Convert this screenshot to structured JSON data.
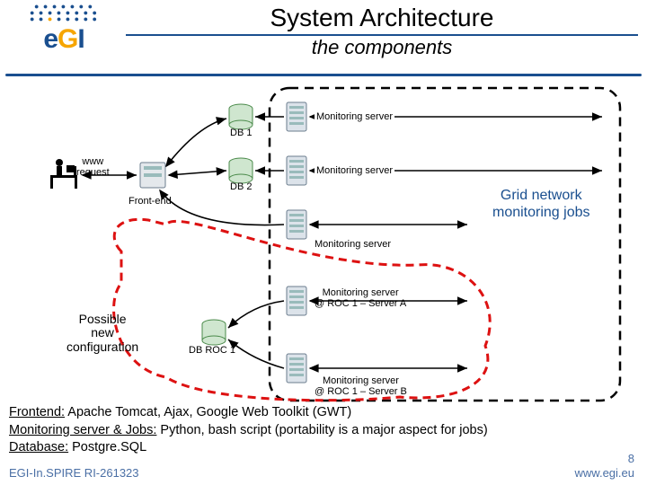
{
  "logo": {
    "text_prefix": "e",
    "text_mid": "G",
    "text_suffix": "I"
  },
  "title": {
    "main": "System Architecture",
    "sub": "the components"
  },
  "labels": {
    "www_request": "www\nrequest",
    "frontend": "Front-end",
    "db1": "DB 1",
    "db2": "DB 2",
    "dbroc1": "DB ROC 1",
    "mon1": "Monitoring server",
    "mon2": "Monitoring server",
    "mon3": "Monitoring server",
    "mon_roc_a": "Monitoring server\n@ ROC 1 – Server A",
    "mon_roc_b": "Monitoring server\n@ ROC 1 – Server B",
    "possible": "Possible\nnew\nconfiguration",
    "grid": "Grid network\nmonitoring jobs"
  },
  "footer": {
    "line1_u": "Frontend:",
    "line1_rest": " Apache Tomcat, Ajax, Google Web Toolkit (GWT)",
    "line2_u": "Monitoring server & Jobs:",
    "line2_rest": " Python, bash script (portability is a major aspect for jobs)",
    "line3_u": "Database:",
    "line3_rest": " Postgre.SQL"
  },
  "ref": "EGI-In.SPIRE RI-261323",
  "pagenum": "8",
  "siteurl": "www.egi.eu",
  "chart_data": {
    "type": "diagram",
    "title": "System Architecture – the components",
    "nodes": [
      {
        "id": "user",
        "label": "www request",
        "type": "actor"
      },
      {
        "id": "frontend",
        "label": "Front-end",
        "type": "server"
      },
      {
        "id": "db1",
        "label": "DB 1",
        "type": "database"
      },
      {
        "id": "db2",
        "label": "DB 2",
        "type": "database"
      },
      {
        "id": "mon1",
        "label": "Monitoring server",
        "type": "server",
        "group": "grid"
      },
      {
        "id": "mon2",
        "label": "Monitoring server",
        "type": "server",
        "group": "grid"
      },
      {
        "id": "mon3",
        "label": "Monitoring server",
        "type": "server",
        "group": "grid"
      },
      {
        "id": "dbroc1",
        "label": "DB ROC 1",
        "type": "database",
        "group": "possible"
      },
      {
        "id": "monroca",
        "label": "Monitoring server @ ROC 1 – Server A",
        "type": "server",
        "group": "possible+grid"
      },
      {
        "id": "monrocb",
        "label": "Monitoring server @ ROC 1 – Server B",
        "type": "server",
        "group": "possible+grid"
      }
    ],
    "edges": [
      {
        "from": "user",
        "to": "frontend",
        "dir": "both"
      },
      {
        "from": "frontend",
        "to": "db1",
        "dir": "both"
      },
      {
        "from": "frontend",
        "to": "db2",
        "dir": "both"
      },
      {
        "from": "db1",
        "to": "mon1",
        "dir": "from"
      },
      {
        "from": "db2",
        "to": "mon2",
        "dir": "from"
      },
      {
        "from": "frontend",
        "to": "mon3",
        "dir": "from",
        "style": "indirect"
      },
      {
        "from": "dbroc1",
        "to": "monroca",
        "dir": "from"
      },
      {
        "from": "dbroc1",
        "to": "monrocb",
        "dir": "from"
      },
      {
        "from": "frontend",
        "to": "dbroc1",
        "dir": "both",
        "style": "dashed"
      }
    ],
    "groups": [
      {
        "id": "grid",
        "label": "Grid network monitoring jobs",
        "style": "dashed-black"
      },
      {
        "id": "possible",
        "label": "Possible new configuration",
        "style": "dashed-red"
      }
    ]
  }
}
